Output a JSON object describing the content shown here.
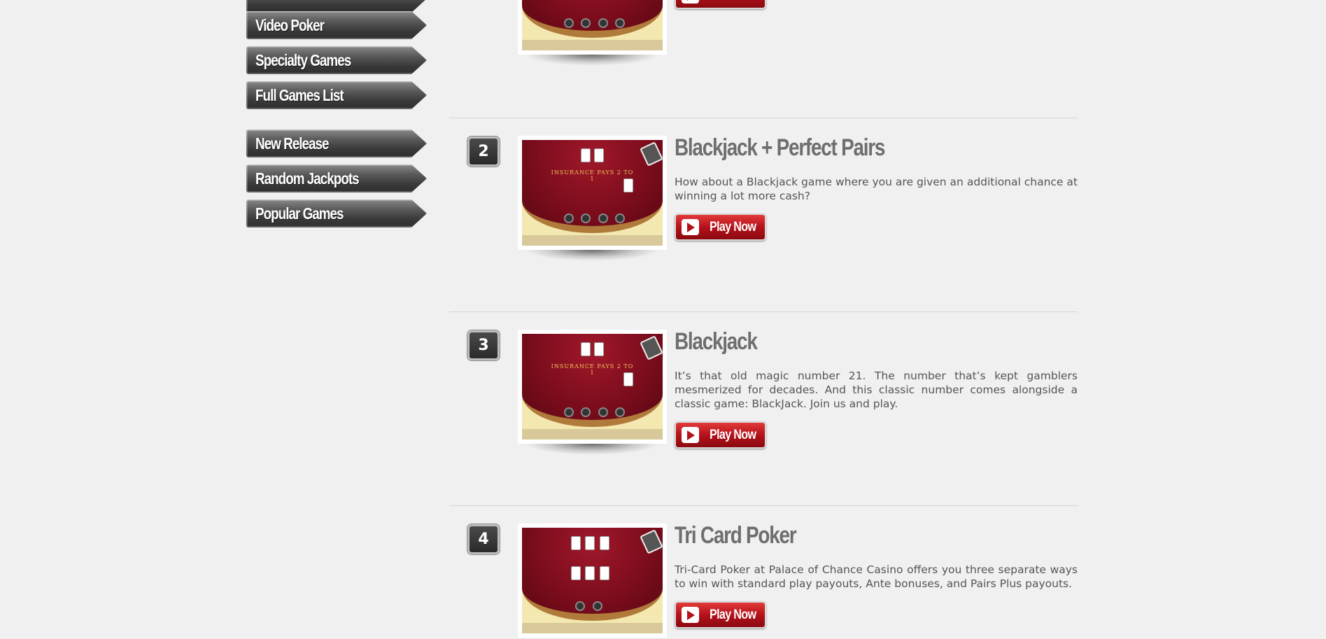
{
  "sidebar": {
    "group_one": [
      {
        "label": ""
      },
      {
        "label": "Video Poker"
      },
      {
        "label": "Specialty Games"
      },
      {
        "label": "Full Games List"
      }
    ],
    "group_two": [
      {
        "label": "New Release"
      },
      {
        "label": "Random Jackpots"
      },
      {
        "label": "Popular Games"
      }
    ]
  },
  "games": [
    {
      "rank": "",
      "title": "",
      "description": "",
      "play_label": ""
    },
    {
      "rank": "2",
      "title": "Blackjack + Perfect Pairs",
      "description": "How about a Blackjack game where you are given an additional chance at winning a lot more cash?",
      "play_label": "Play Now"
    },
    {
      "rank": "3",
      "title": "Blackjack",
      "description": "It’s that old magic number 21. The number that’s kept gamblers mesmerized for decades. And this classic number comes alongside a classic game: BlackJack. Join us and play.",
      "play_label": "Play Now"
    },
    {
      "rank": "4",
      "title": "Tri Card Poker",
      "description": "Tri-Card Poker at Palace of Chance Casino offers you three separate ways to win with standard play payouts, Ante bonuses, and Pairs Plus payouts.",
      "play_label": "Play Now"
    }
  ],
  "thumbnails": {
    "table_text": "INSURANCE PAYS 2 TO 1",
    "brand": "Palace of Chance"
  },
  "colors": {
    "background": "#f0f0f0",
    "play_button": "#b5111a",
    "title": "#6e6e6e",
    "rank_badge": "#2a2a2a"
  }
}
